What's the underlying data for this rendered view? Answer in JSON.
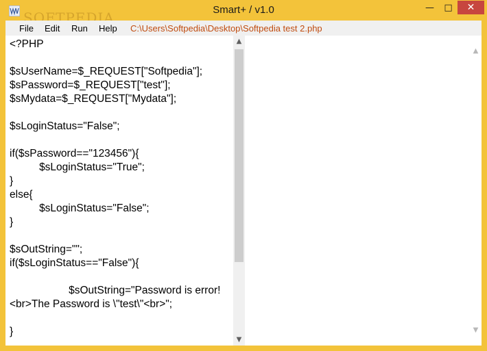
{
  "window": {
    "title": "Smart+ / v1.0",
    "watermark": "SOFTPEDIA",
    "controls": {
      "minimize": "—",
      "maximize": "□",
      "close": "✕"
    }
  },
  "menu": {
    "items": [
      "File",
      "Edit",
      "Run",
      "Help"
    ],
    "file_path": "C:\\Users\\Softpedia\\Desktop\\Softpedia test 2.php"
  },
  "editor": {
    "code": "<?PHP\n\n$sUserName=$_REQUEST[\"Softpedia\"];\n$sPassword=$_REQUEST[\"test\"];\n$sMydata=$_REQUEST[\"Mydata\"];\n\n$sLoginStatus=\"False\";\n\nif($sPassword==\"123456\"){\n          $sLoginStatus=\"True\";\n}\nelse{\n          $sLoginStatus=\"False\";\n}\n\n$sOutString=\"\";\nif($sLoginStatus==\"False\"){\n\n                    $sOutString=\"Password is error!\n<br>The Password is \\\"test\\\"<br>\";\n\n}"
  },
  "scrollbar": {
    "up": "▲",
    "down": "▼"
  },
  "colors": {
    "frame": "#f3c33a",
    "close": "#c7463f",
    "path": "#c04c10"
  }
}
